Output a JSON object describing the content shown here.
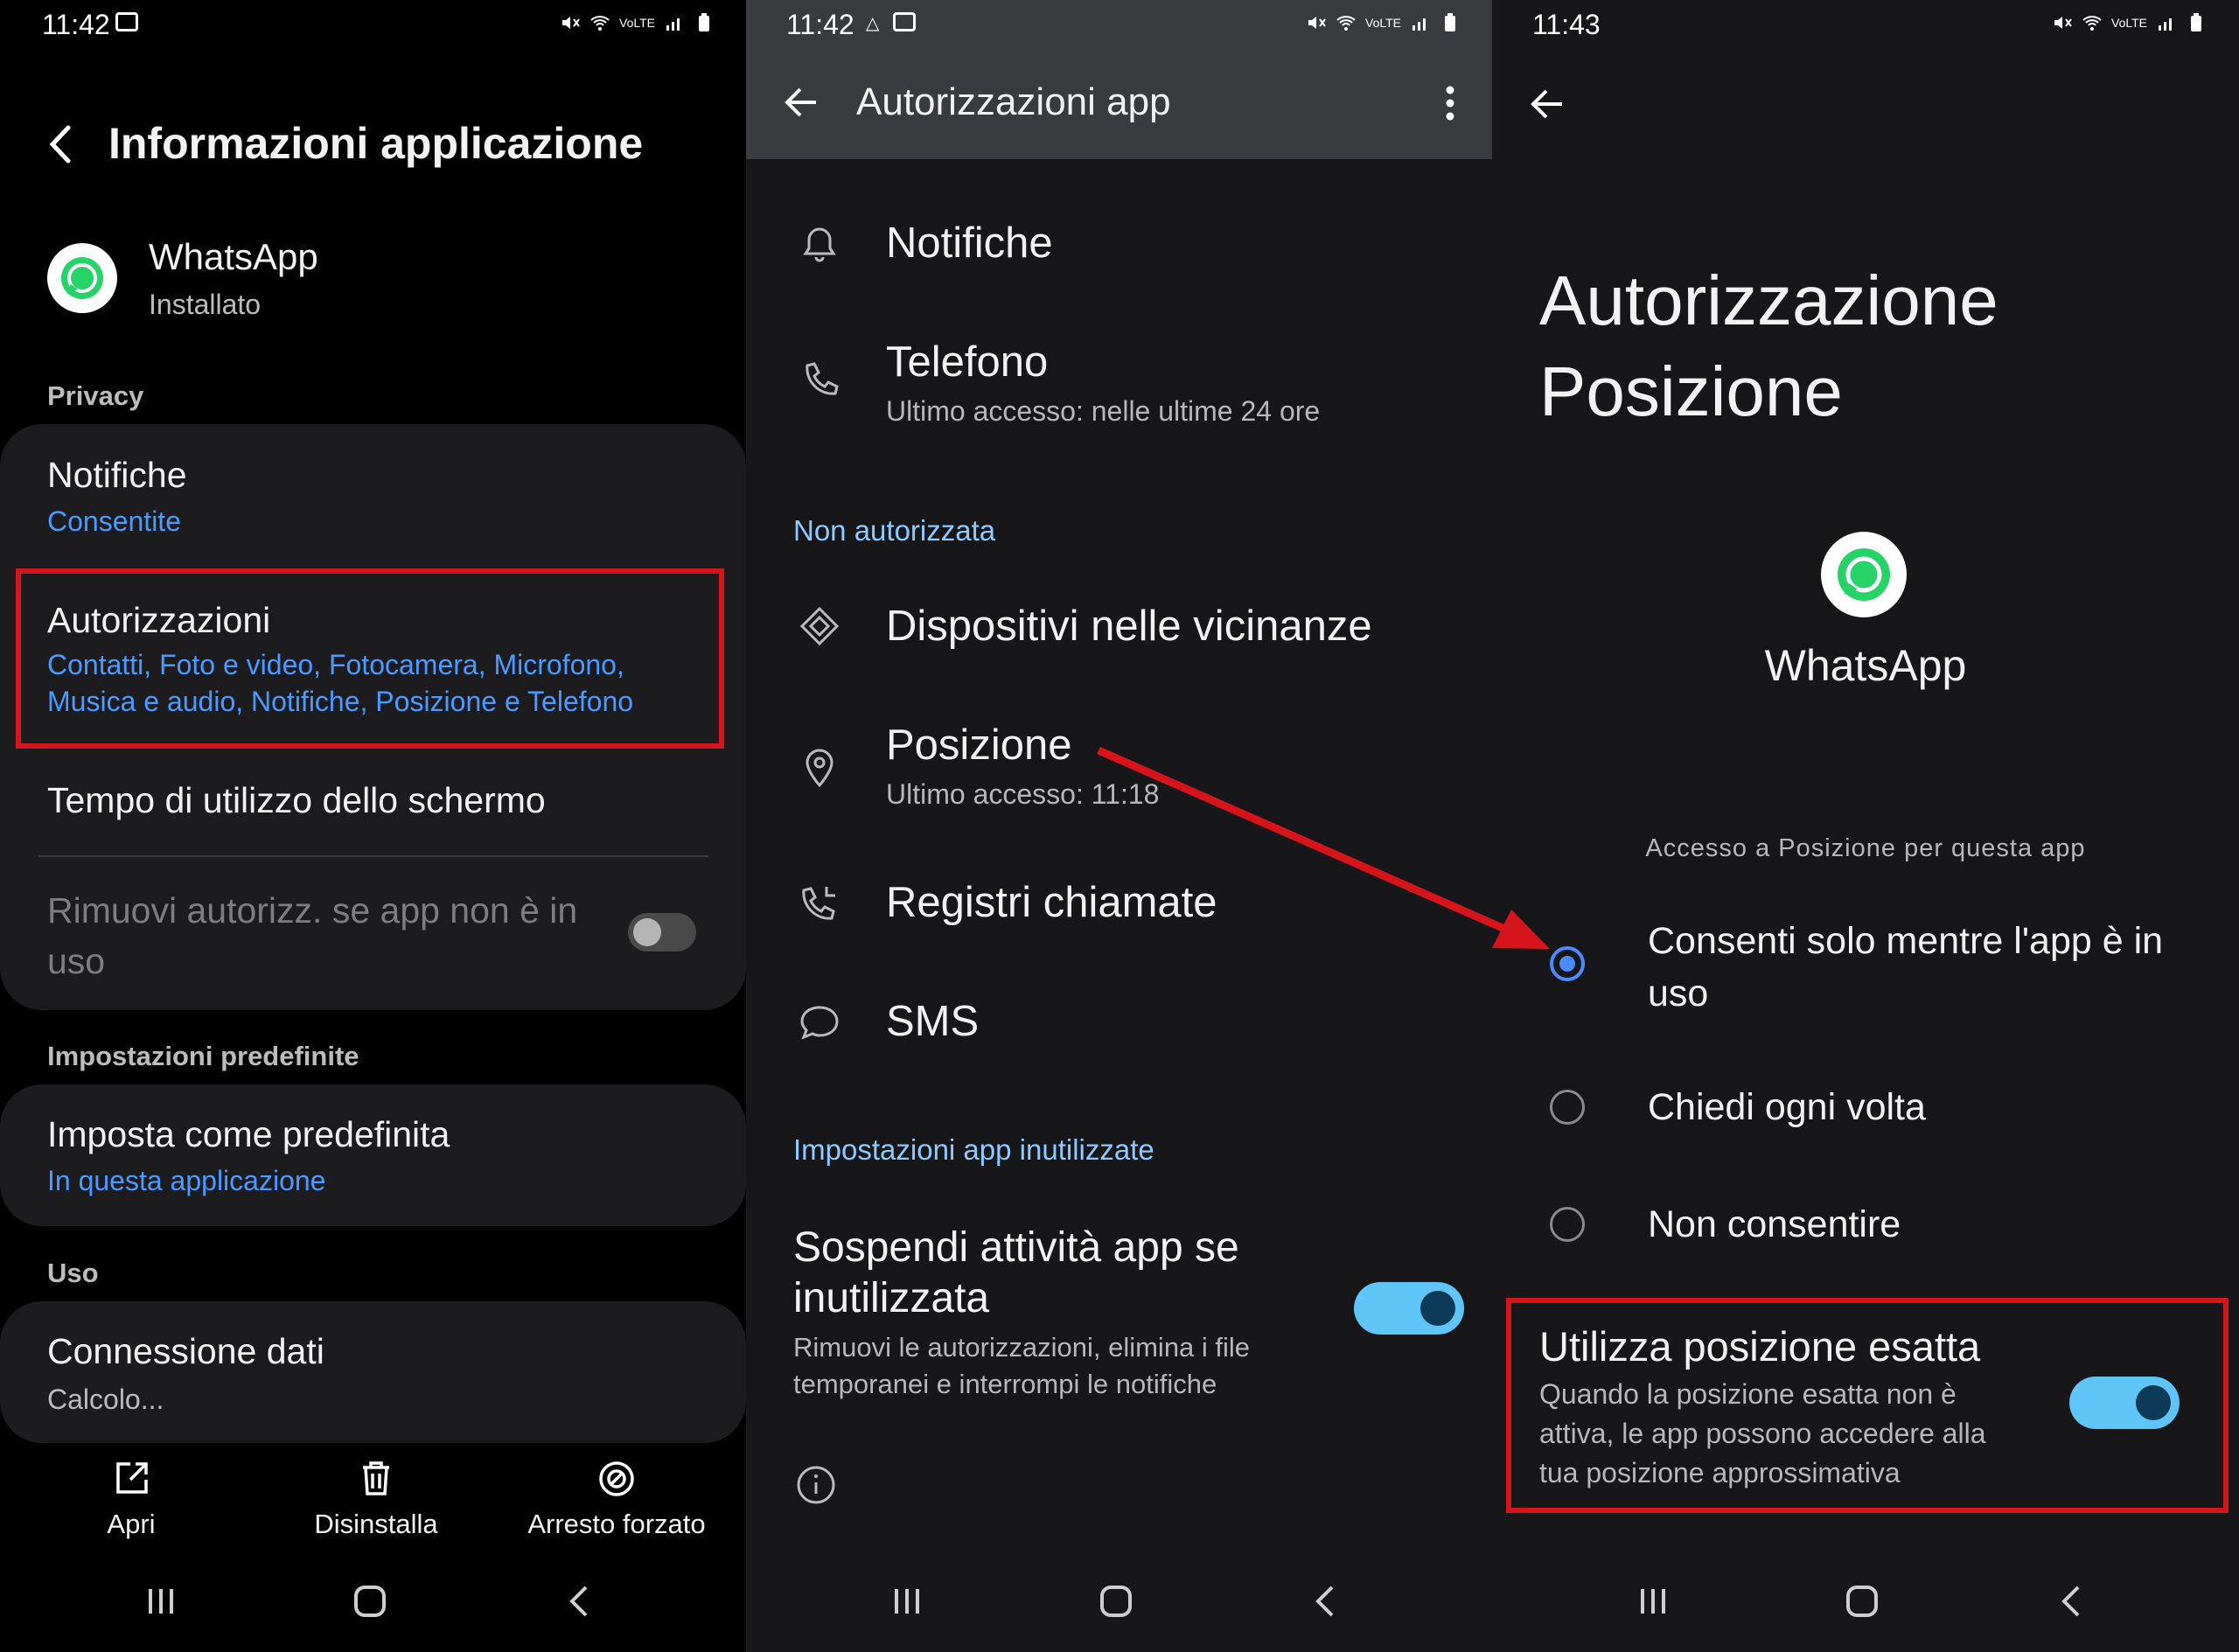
{
  "panel1": {
    "status_time": "11:42",
    "title": "Informazioni applicazione",
    "app": {
      "name": "WhatsApp",
      "status": "Installato"
    },
    "privacy_header": "Privacy",
    "notifiche": {
      "title": "Notifiche",
      "sub": "Consentite"
    },
    "autorizzazioni": {
      "title": "Autorizzazioni",
      "sub_line1": "Contatti, Foto e video, Fotocamera, Microfono,",
      "sub_line2": "Musica e audio, Notifiche, Posizione e Telefono"
    },
    "tempo": "Tempo di utilizzo dello schermo",
    "rimuovi": {
      "line1": "Rimuovi autorizz. se app non è in",
      "line2": "uso",
      "toggle_on": false
    },
    "default_header": "Impostazioni predefinite",
    "predefinita": {
      "title": "Imposta come predefinita",
      "sub": "In questa applicazione"
    },
    "uso_header": "Uso",
    "connessione": {
      "title": "Connessione dati",
      "sub": "Calcolo..."
    },
    "actions": {
      "open": "Apri",
      "uninstall": "Disinstalla",
      "force_stop": "Arresto forzato"
    }
  },
  "panel2": {
    "status_time": "11:42",
    "title": "Autorizzazioni app",
    "notifiche": "Notifiche",
    "telefono": {
      "title": "Telefono",
      "sub": "Ultimo accesso: nelle ultime 24 ore"
    },
    "non_autorizzata": "Non autorizzata",
    "dispositivi": "Dispositivi nelle vicinanze",
    "posizione": {
      "title": "Posizione",
      "sub": "Ultimo accesso: 11:18"
    },
    "registri": "Registri chiamate",
    "sms": "SMS",
    "inutilizzate_header": "Impostazioni app inutilizzate",
    "sospendi": {
      "line1": "Sospendi attività app se",
      "line2": "inutilizzata",
      "sub_line1": "Rimuovi le autorizzazioni, elimina i file",
      "sub_line2": "temporanei e interrompi le notifiche",
      "toggle_on": true
    }
  },
  "panel3": {
    "status_time": "11:43",
    "title_line1": "Autorizzazione",
    "title_line2": "Posizione",
    "app_name": "WhatsApp",
    "access_label": "Accesso a Posizione per questa app",
    "options": [
      {
        "line1": "Consenti solo mentre l'app è in",
        "line2": "uso",
        "selected": true
      },
      {
        "line1": "Chiedi ogni volta",
        "line2": "",
        "selected": false
      },
      {
        "line1": "Non consentire",
        "line2": "",
        "selected": false
      }
    ],
    "esatta": {
      "title": "Utilizza posizione esatta",
      "sub_line1": "Quando la posizione esatta non è",
      "sub_line2": "attiva, le app possono accedere alla",
      "sub_line3": "tua posizione approssimativa",
      "toggle_on": true
    }
  },
  "colors": {
    "accent_blue": "#4a9bff",
    "highlight_red": "#d5141c",
    "toggle_on": "#5fc4f6",
    "whatsapp_green": "#25d366"
  }
}
